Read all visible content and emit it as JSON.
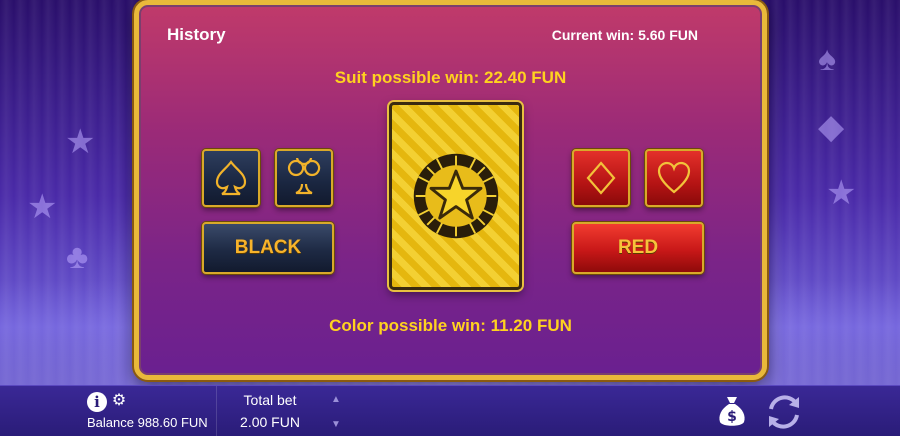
{
  "header": {
    "history_label": "History",
    "current_win": "Current win: 5.60 FUN"
  },
  "gamble": {
    "suit_possible_win": "Suit possible win: 22.40 FUN",
    "color_possible_win": "Color possible win: 11.20 FUN",
    "black_label": "BLACK",
    "red_label": "RED",
    "suits": [
      {
        "name": "spade-icon",
        "color": "dark"
      },
      {
        "name": "club-icon",
        "color": "dark"
      },
      {
        "name": "diamond-icon",
        "color": "red"
      },
      {
        "name": "heart-icon",
        "color": "red"
      }
    ],
    "card_back_icon": "star-icon"
  },
  "bottom_bar": {
    "info_icon": "info-icon",
    "settings_icon": "gear-icon",
    "balance": "Balance 988.60 FUN",
    "total_bet_label": "Total bet",
    "total_bet_value": "2.00 FUN",
    "bet_up_icon": "chevron-up-icon",
    "bet_down_icon": "chevron-down-icon",
    "collect_icon": "money-bag-icon",
    "autoplay_icon": "autoplay-icon"
  },
  "colors": {
    "gold": "#e9b93a",
    "yellow_text": "#ffd21f",
    "panel_top": "#c03a6a",
    "panel_bottom": "#6a2090",
    "red_button": "#c81818",
    "dark_button": "#1e2a44"
  }
}
